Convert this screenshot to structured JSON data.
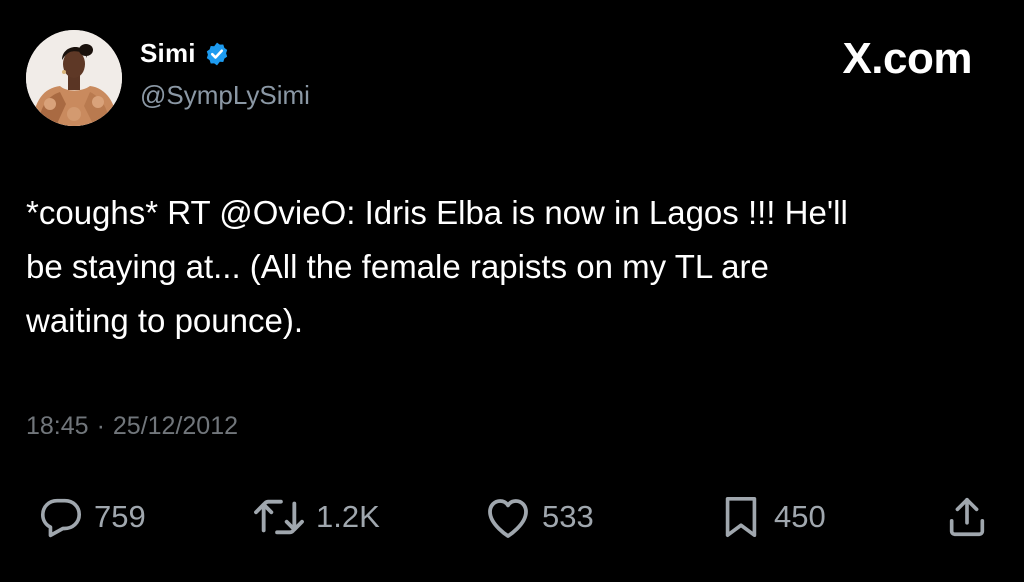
{
  "author": {
    "display_name": "Simi",
    "handle": "@SympLySimi",
    "verified": true,
    "verified_color": "#1d9bf0",
    "avatar_icon": "profile-photo"
  },
  "brand": {
    "label": "X.com"
  },
  "tweet": {
    "text": "*coughs* RT @OvieO: Idris Elba is now in Lagos !!! He'll\nbe staying at... (All the female rapists on my TL are\nwaiting to pounce).",
    "time": "18:45",
    "separator": "·",
    "date": "25/12/2012"
  },
  "actions": {
    "reply": {
      "icon": "reply-icon",
      "count": "759"
    },
    "retweet": {
      "icon": "retweet-icon",
      "count": "1.2K"
    },
    "like": {
      "icon": "heart-icon",
      "count": "533"
    },
    "bookmark": {
      "icon": "bookmark-icon",
      "count": "450"
    },
    "share": {
      "icon": "share-icon"
    }
  },
  "colors": {
    "background": "#000000",
    "text": "#ffffff",
    "secondary": "#8b98a5",
    "icon": "#a0a7ae"
  }
}
